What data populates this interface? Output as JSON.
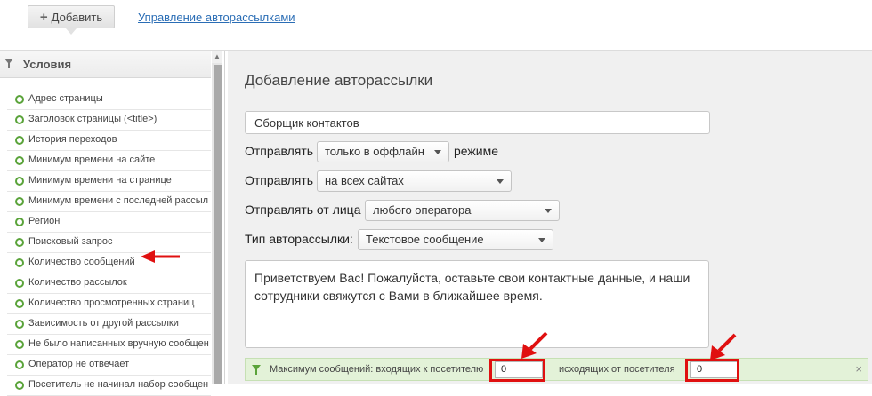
{
  "toolbar": {
    "add_label": "Добавить",
    "manage_link": "Управление авторассылками"
  },
  "sidebar": {
    "title": "Условия",
    "items": [
      "Адрес страницы",
      "Заголовок страницы (<title>)",
      "История переходов",
      "Минимум времени на сайте",
      "Минимум времени на странице",
      "Минимум времени с последней рассыл",
      "Регион",
      "Поисковый запрос",
      "Количество сообщений",
      "Количество рассылок",
      "Количество просмотренных страниц",
      "Зависимость от другой рассылки",
      "Не было написанных вручную сообщен",
      "Оператор не отвечает",
      "Посетитель не начинал набор сообщен"
    ]
  },
  "main": {
    "title": "Добавление авторассылки",
    "name_value": "Сборщик контактов",
    "send_mode": {
      "label": "Отправлять",
      "value": "только в оффлайн",
      "suffix": "режиме"
    },
    "send_sites": {
      "label": "Отправлять",
      "value": "на всех сайтах"
    },
    "send_from": {
      "label": "Отправлять от лица",
      "value": "любого оператора"
    },
    "type": {
      "label": "Тип авторассылки:",
      "value": "Текстовое сообщение"
    },
    "message": "Приветствуем Вас! Пожалуйста, оставьте свои контактные данные, и наши сотрудники свяжутся с Вами в ближайшее время.",
    "condition": {
      "label_incoming": "Максимум сообщений: входящих к посетителю",
      "incoming_value": "0",
      "label_outgoing": "исходящих от посетителя",
      "outgoing_value": "0",
      "close": "×"
    }
  },
  "colors": {
    "annotation": "#e01010",
    "ring": "#5aa33a",
    "link": "#2a6db5",
    "condition_bg": "#e3f2d8"
  }
}
